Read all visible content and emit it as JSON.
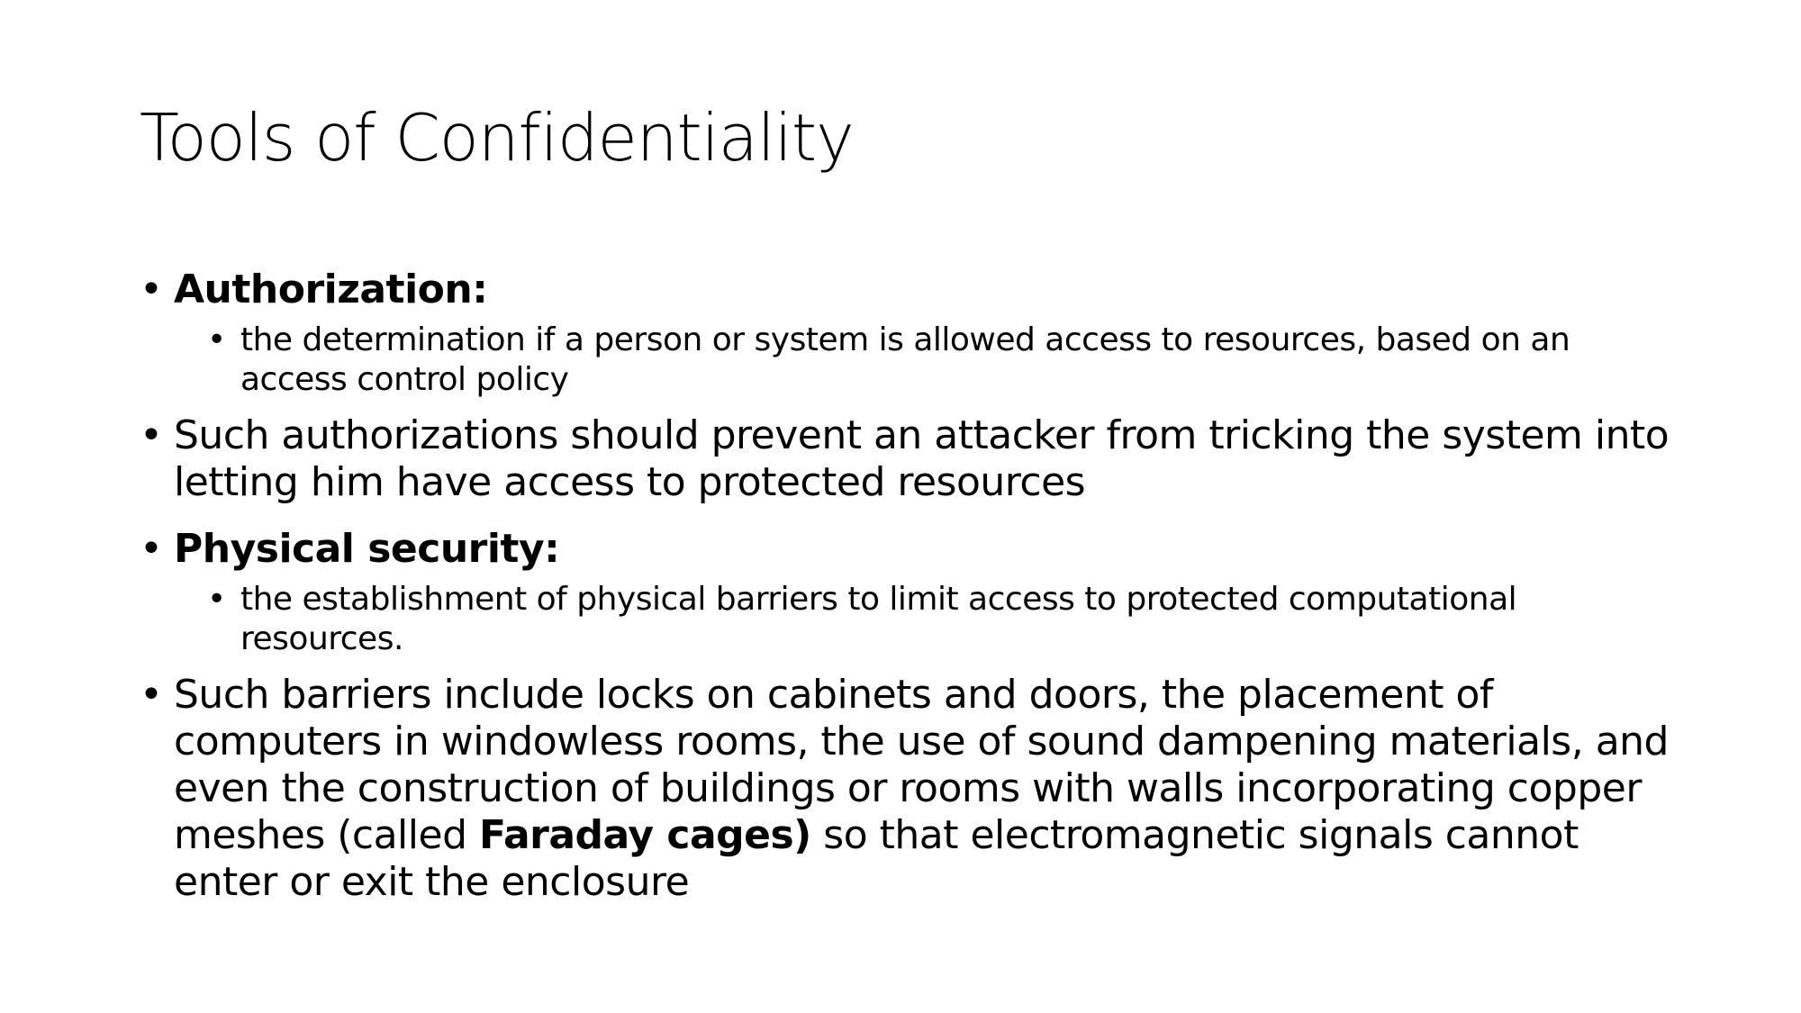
{
  "slide": {
    "title": "Tools of Confidentiality",
    "bullet_glyph": "•",
    "items": [
      {
        "heading": "Authorization:",
        "sub": "the determination if a person or system is allowed access to resources, based on an access control policy"
      },
      {
        "text": "Such authorizations should prevent an attacker from tricking the system into letting him have access to protected resources"
      },
      {
        "heading": "Physical security:",
        "sub": "the establishment of physical barriers to limit access to protected computational resources."
      },
      {
        "text_before": "Such barriers include locks on cabinets and doors, the placement of computers in windowless rooms, the use of sound dampening materials, and even the construction of buildings or rooms with walls incorporating copper meshes (called ",
        "text_bold": "Faraday cages)",
        "text_after": " so that electromagnetic signals cannot enter or exit the enclosure"
      }
    ]
  }
}
